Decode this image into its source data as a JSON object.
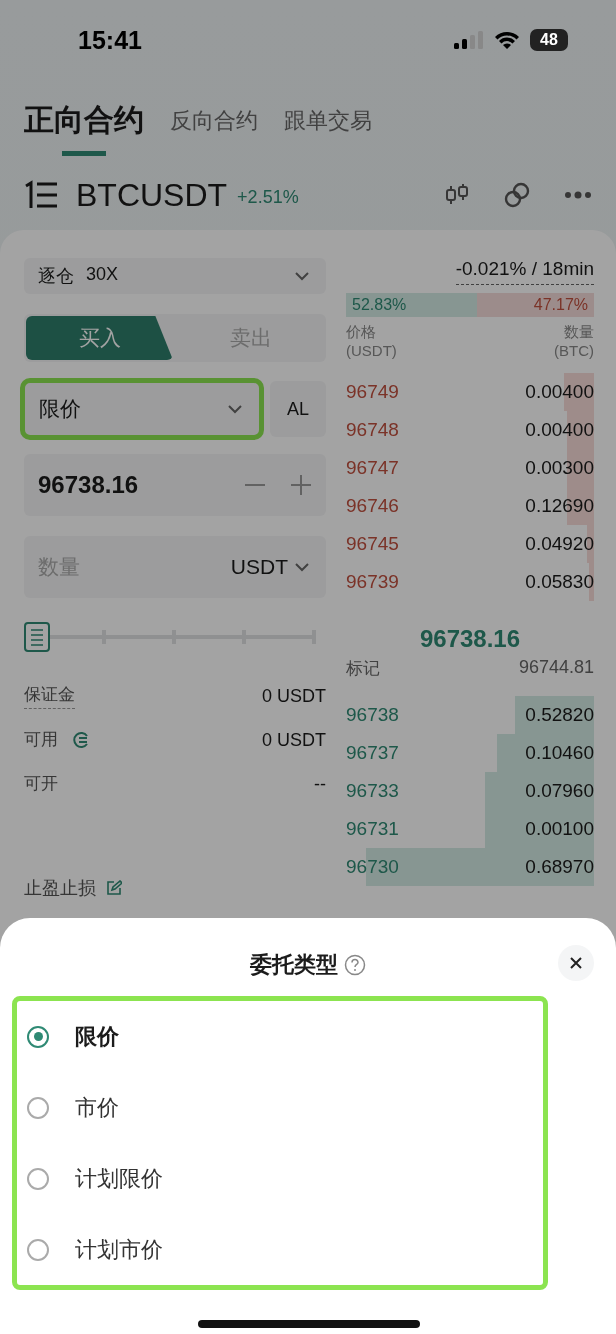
{
  "status_bar": {
    "time": "15:41",
    "battery": "48"
  },
  "tabs": [
    {
      "label": "正向合约",
      "selected": true
    },
    {
      "label": "反向合约",
      "selected": false
    },
    {
      "label": "跟单交易",
      "selected": false
    }
  ],
  "header": {
    "symbol": "BTCUSDT",
    "change": "+2.51%"
  },
  "order_form": {
    "margin_mode": "逐仓",
    "leverage": "30X",
    "sides": [
      {
        "label": "买入",
        "selected": true
      },
      {
        "label": "卖出",
        "selected": false
      }
    ],
    "order_type": "限价",
    "extra_button": "AL",
    "price": "96738.16",
    "quantity": {
      "placeholder": "数量",
      "unit": "USDT"
    },
    "slider": {
      "level": 0
    },
    "info": [
      {
        "label": "保证金",
        "value": "0 USDT",
        "kind": "dashed"
      },
      {
        "label": "可用",
        "value": "0 USDT",
        "kind": "transfer"
      },
      {
        "label": "可开",
        "value": "--",
        "kind": "plain"
      }
    ],
    "tp_sl": "止盈止损"
  },
  "order_book": {
    "funding": "-0.021% / 18min",
    "ratio": {
      "buy": "52.83%",
      "sell": "47.17%",
      "level": 0.5283
    },
    "price_label": "价格",
    "price_unit": "(USDT)",
    "qty_label": "数量",
    "qty_unit": "(BTC)",
    "asks": [
      {
        "price": "96749",
        "qty": "0.00400"
      },
      {
        "price": "96748",
        "qty": "0.00400"
      },
      {
        "price": "96747",
        "qty": "0.00300"
      },
      {
        "price": "96746",
        "qty": "0.12690"
      },
      {
        "price": "96745",
        "qty": "0.04920"
      },
      {
        "price": "96739",
        "qty": "0.05830"
      }
    ],
    "last_price": "96738.16",
    "mark": {
      "label": "标记",
      "value": "96744.81"
    },
    "bids": [
      {
        "price": "96738",
        "qty": "0.52820"
      },
      {
        "price": "96737",
        "qty": "0.10460"
      },
      {
        "price": "96733",
        "qty": "0.07960"
      },
      {
        "price": "96731",
        "qty": "0.00100"
      },
      {
        "price": "96730",
        "qty": "0.68970"
      }
    ]
  },
  "sheet": {
    "title": "委托类型",
    "options": [
      {
        "label": "限价",
        "selected": true
      },
      {
        "label": "市价",
        "selected": false
      },
      {
        "label": "计划限价",
        "selected": false
      },
      {
        "label": "计划市价",
        "selected": false
      }
    ]
  }
}
